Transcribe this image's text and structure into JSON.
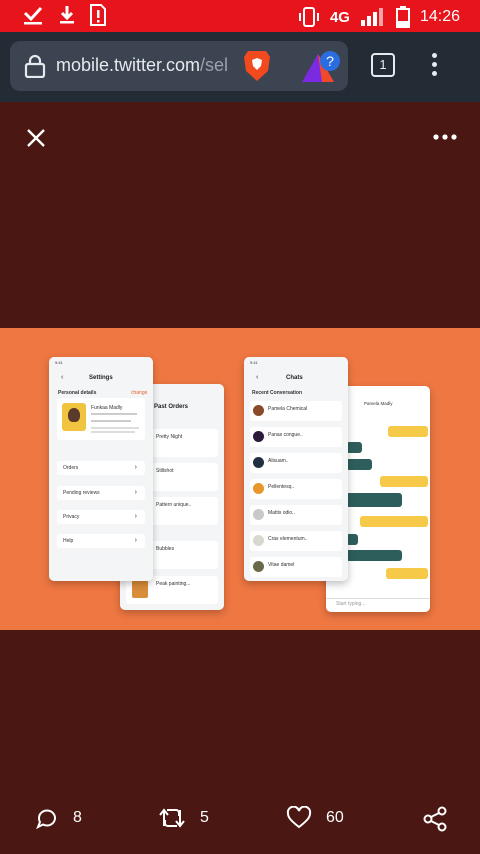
{
  "status_bar": {
    "time": "14:26",
    "network": "4G",
    "icons": [
      "download-done-icon",
      "download-icon",
      "sim-alert-icon",
      "vibrate-icon",
      "signal-icon",
      "battery-low-icon"
    ]
  },
  "browser": {
    "url_main": "mobile.twitter.com",
    "url_rest": "/sel",
    "tab_count": "1"
  },
  "image": {
    "settings_screen": {
      "title": "Settings",
      "section": "Personal details",
      "change_label": "change",
      "name": "Funkaa Madly",
      "menu": [
        "Orders",
        "Pending reviews",
        "Privacy",
        "Help"
      ]
    },
    "orders_screen": {
      "title": "Past Orders",
      "items": [
        "Pretty Night",
        "Stillshot",
        "Pattern unique..",
        "Bubbles",
        "Peak painting..."
      ]
    },
    "chats_screen": {
      "title": "Chats",
      "section": "Recent Conversation",
      "items": [
        "Pamela Chemical",
        "Panas congue..",
        "Alisuam..",
        "Pellentesq..",
        "Mattis odio..",
        "Cras elementum..",
        "Vitae damel"
      ]
    },
    "conversation_screen": {
      "contact": "Pamela Madly",
      "input_placeholder": "Start typing..."
    }
  },
  "actions": {
    "replies": "8",
    "retweets": "5",
    "likes": "60"
  }
}
